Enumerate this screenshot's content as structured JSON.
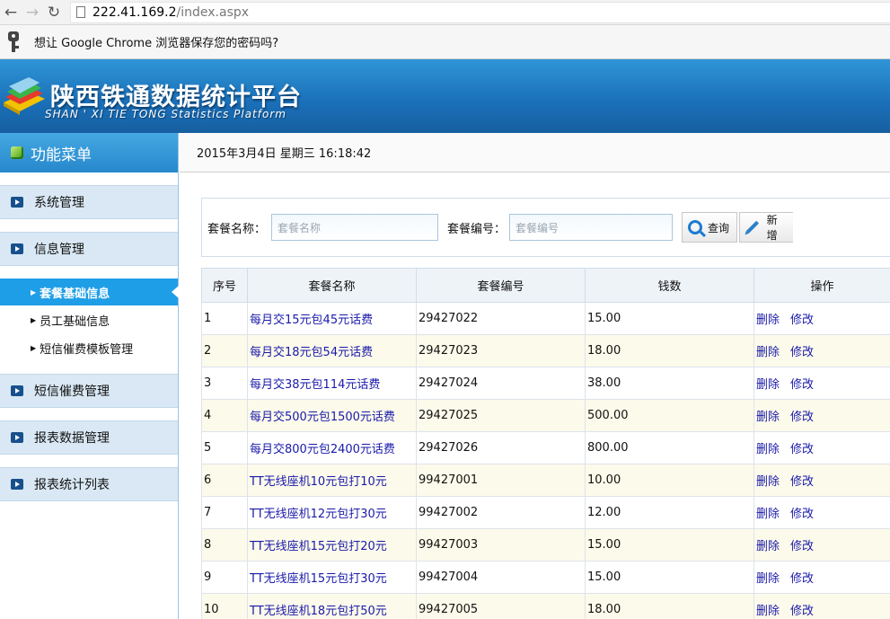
{
  "browser": {
    "back_icon": "back-arrow-icon",
    "forward_icon": "forward-arrow-icon",
    "reload_icon": "reload-icon",
    "url_host": "222.41.169.2",
    "url_path": "/index.aspx",
    "infobar_text": "想让 Google Chrome 浏览器保存您的密码吗?"
  },
  "app": {
    "title": "陕西铁通数据统计平台",
    "subtitle": "SHAN ' XI TIE TONG Statistics  Platform"
  },
  "sidebar": {
    "header": "功能菜单",
    "items": [
      {
        "label": "系统管理"
      },
      {
        "label": "信息管理"
      },
      {
        "label": "短信催费管理"
      },
      {
        "label": "报表数据管理"
      },
      {
        "label": "报表统计列表"
      }
    ],
    "subitems": [
      {
        "label": "套餐基础信息",
        "active": true
      },
      {
        "label": "员工基础信息",
        "active": false
      },
      {
        "label": "短信催费模板管理",
        "active": false
      }
    ]
  },
  "datetime": "2015年3月4日 星期三 16:18:42",
  "search": {
    "name_label": "套餐名称：",
    "name_placeholder": "套餐名称",
    "code_label": "套餐编号：",
    "code_placeholder": "套餐编号",
    "query_button": "查询",
    "add_button": "新增"
  },
  "table": {
    "headers": [
      "序号",
      "套餐名称",
      "套餐编号",
      "钱数",
      "操作"
    ],
    "delete_label": "删除",
    "edit_label": "修改",
    "rows": [
      {
        "no": "1",
        "name": "每月交15元包45元话费",
        "code": "29427022",
        "amount": "15.00"
      },
      {
        "no": "2",
        "name": "每月交18元包54元话费",
        "code": "29427023",
        "amount": "18.00"
      },
      {
        "no": "3",
        "name": "每月交38元包114元话费",
        "code": "29427024",
        "amount": "38.00"
      },
      {
        "no": "4",
        "name": "每月交500元包1500元话费",
        "code": "29427025",
        "amount": "500.00"
      },
      {
        "no": "5",
        "name": "每月交800元包2400元话费",
        "code": "29427026",
        "amount": "800.00"
      },
      {
        "no": "6",
        "name": "TT无线座机10元包打10元",
        "code": "99427001",
        "amount": "10.00"
      },
      {
        "no": "7",
        "name": "TT无线座机12元包打30元",
        "code": "99427002",
        "amount": "12.00"
      },
      {
        "no": "8",
        "name": "TT无线座机15元包打20元",
        "code": "99427003",
        "amount": "15.00"
      },
      {
        "no": "9",
        "name": "TT无线座机15元包打30元",
        "code": "99427004",
        "amount": "15.00"
      },
      {
        "no": "10",
        "name": "TT无线座机18元包打50元",
        "code": "99427005",
        "amount": "18.00"
      }
    ]
  }
}
